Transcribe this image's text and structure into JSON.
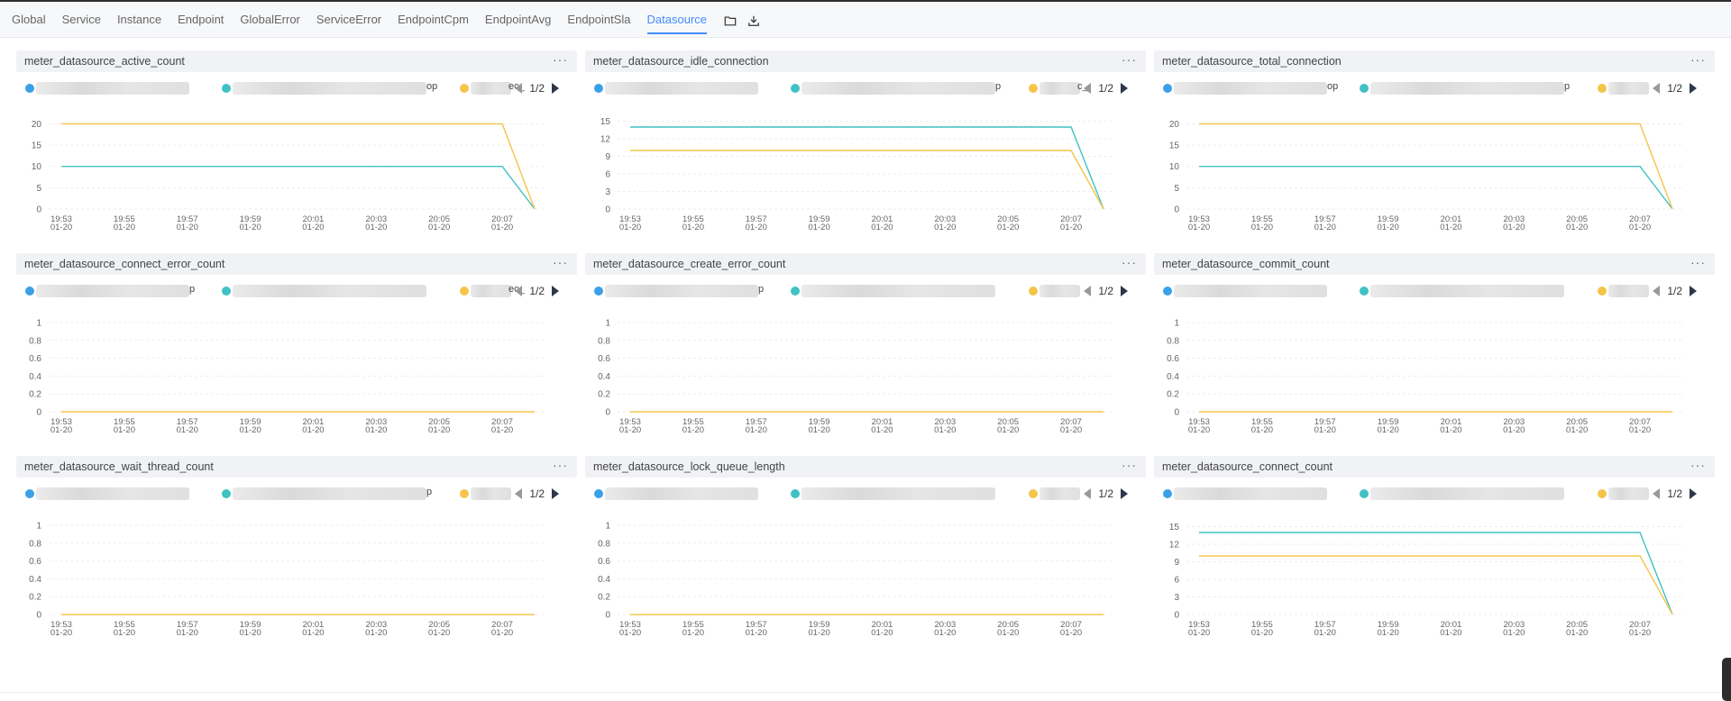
{
  "tabs": [
    {
      "label": "Global",
      "active": false
    },
    {
      "label": "Service",
      "active": false
    },
    {
      "label": "Instance",
      "active": false
    },
    {
      "label": "Endpoint",
      "active": false
    },
    {
      "label": "GlobalError",
      "active": false
    },
    {
      "label": "ServiceError",
      "active": false
    },
    {
      "label": "EndpointCpm",
      "active": false
    },
    {
      "label": "EndpointAvg",
      "active": false
    },
    {
      "label": "EndpointSla",
      "active": false
    },
    {
      "label": "Datasource",
      "active": true
    }
  ],
  "toolbar_icons": [
    "folder-icon",
    "download-icon"
  ],
  "colors": {
    "blue": "#3aa1e8",
    "teal": "#40c1c4",
    "yellow": "#f5c54b",
    "accent": "#448dfe"
  },
  "x_ticks": [
    {
      "time": "19:53",
      "date": "01-20"
    },
    {
      "time": "19:55",
      "date": "01-20"
    },
    {
      "time": "19:57",
      "date": "01-20"
    },
    {
      "time": "19:59",
      "date": "01-20"
    },
    {
      "time": "20:01",
      "date": "01-20"
    },
    {
      "time": "20:03",
      "date": "01-20"
    },
    {
      "time": "20:05",
      "date": "01-20"
    },
    {
      "time": "20:07",
      "date": "01-20"
    }
  ],
  "panels": [
    {
      "title": "meter_datasource_active_count",
      "menu": "···",
      "legend": {
        "tails": [
          "",
          "op",
          "ec_"
        ],
        "page": "1/2"
      },
      "chart_data": {
        "type": "line",
        "x": [
          "19:53",
          "19:54",
          "19:55",
          "19:56",
          "19:57",
          "19:58",
          "19:59",
          "20:00",
          "20:01",
          "20:02",
          "20:03",
          "20:04",
          "20:05",
          "20:06",
          "20:07",
          "20:08"
        ],
        "yticks": [
          "0",
          "5",
          "10",
          "15",
          "20"
        ],
        "ylim": [
          0,
          22
        ],
        "series": [
          {
            "color": "#40c1c4",
            "values": [
              10,
              10,
              10,
              10,
              10,
              10,
              10,
              10,
              10,
              10,
              10,
              10,
              10,
              10,
              10,
              0
            ]
          },
          {
            "color": "#f5c54b",
            "values": [
              20,
              20,
              20,
              20,
              20,
              20,
              20,
              20,
              20,
              20,
              20,
              20,
              20,
              20,
              20,
              0
            ]
          }
        ]
      }
    },
    {
      "title": "meter_datasource_idle_connection",
      "menu": "···",
      "legend": {
        "tails": [
          "",
          "p",
          "c_"
        ],
        "page": "1/2"
      },
      "chart_data": {
        "type": "line",
        "x": [
          "19:53",
          "19:54",
          "19:55",
          "19:56",
          "19:57",
          "19:58",
          "19:59",
          "20:00",
          "20:01",
          "20:02",
          "20:03",
          "20:04",
          "20:05",
          "20:06",
          "20:07",
          "20:08"
        ],
        "yticks": [
          "0",
          "3",
          "6",
          "9",
          "12",
          "15"
        ],
        "ylim": [
          0,
          16
        ],
        "series": [
          {
            "color": "#40c1c4",
            "values": [
              14,
              14,
              14,
              14,
              14,
              14,
              14,
              14,
              14,
              14,
              14,
              14,
              14,
              14,
              14,
              0
            ]
          },
          {
            "color": "#f5c54b",
            "values": [
              10,
              10,
              10,
              10,
              10,
              10,
              10,
              10,
              10,
              10,
              10,
              10,
              10,
              10,
              10,
              0
            ]
          }
        ]
      }
    },
    {
      "title": "meter_datasource_total_connection",
      "menu": "···",
      "legend": {
        "tails": [
          "op",
          "p",
          ""
        ],
        "page": "1/2"
      },
      "chart_data": {
        "type": "line",
        "x": [
          "19:53",
          "19:54",
          "19:55",
          "19:56",
          "19:57",
          "19:58",
          "19:59",
          "20:00",
          "20:01",
          "20:02",
          "20:03",
          "20:04",
          "20:05",
          "20:06",
          "20:07",
          "20:08"
        ],
        "yticks": [
          "0",
          "5",
          "10",
          "15",
          "20"
        ],
        "ylim": [
          0,
          22
        ],
        "series": [
          {
            "color": "#40c1c4",
            "values": [
              10,
              10,
              10,
              10,
              10,
              10,
              10,
              10,
              10,
              10,
              10,
              10,
              10,
              10,
              10,
              0
            ]
          },
          {
            "color": "#f5c54b",
            "values": [
              20,
              20,
              20,
              20,
              20,
              20,
              20,
              20,
              20,
              20,
              20,
              20,
              20,
              20,
              20,
              0
            ]
          }
        ]
      }
    },
    {
      "title": "meter_datasource_connect_error_count",
      "menu": "···",
      "legend": {
        "tails": [
          "p",
          "",
          "ec_"
        ],
        "page": "1/2"
      },
      "chart_data": {
        "type": "line",
        "x": [
          "19:53",
          "19:54",
          "19:55",
          "19:56",
          "19:57",
          "19:58",
          "19:59",
          "20:00",
          "20:01",
          "20:02",
          "20:03",
          "20:04",
          "20:05",
          "20:06",
          "20:07",
          "20:08"
        ],
        "yticks": [
          "0",
          "0.2",
          "0.4",
          "0.6",
          "0.8",
          "1"
        ],
        "ylim": [
          0,
          1.05
        ],
        "series": [
          {
            "color": "#f5c54b",
            "values": [
              0,
              0,
              0,
              0,
              0,
              0,
              0,
              0,
              0,
              0,
              0,
              0,
              0,
              0,
              0,
              0
            ]
          }
        ]
      }
    },
    {
      "title": "meter_datasource_create_error_count",
      "menu": "···",
      "legend": {
        "tails": [
          "p",
          "",
          ""
        ],
        "page": "1/2"
      },
      "chart_data": {
        "type": "line",
        "x": [
          "19:53",
          "19:54",
          "19:55",
          "19:56",
          "19:57",
          "19:58",
          "19:59",
          "20:00",
          "20:01",
          "20:02",
          "20:03",
          "20:04",
          "20:05",
          "20:06",
          "20:07",
          "20:08"
        ],
        "yticks": [
          "0",
          "0.2",
          "0.4",
          "0.6",
          "0.8",
          "1"
        ],
        "ylim": [
          0,
          1.05
        ],
        "series": [
          {
            "color": "#f5c54b",
            "values": [
              0,
              0,
              0,
              0,
              0,
              0,
              0,
              0,
              0,
              0,
              0,
              0,
              0,
              0,
              0,
              0
            ]
          }
        ]
      }
    },
    {
      "title": "meter_datasource_commit_count",
      "menu": "···",
      "legend": {
        "tails": [
          "",
          "",
          ""
        ],
        "page": "1/2"
      },
      "chart_data": {
        "type": "line",
        "x": [
          "19:53",
          "19:54",
          "19:55",
          "19:56",
          "19:57",
          "19:58",
          "19:59",
          "20:00",
          "20:01",
          "20:02",
          "20:03",
          "20:04",
          "20:05",
          "20:06",
          "20:07",
          "20:08"
        ],
        "yticks": [
          "0",
          "0.2",
          "0.4",
          "0.6",
          "0.8",
          "1"
        ],
        "ylim": [
          0,
          1.05
        ],
        "series": [
          {
            "color": "#f5c54b",
            "values": [
              0,
              0,
              0,
              0,
              0,
              0,
              0,
              0,
              0,
              0,
              0,
              0,
              0,
              0,
              0,
              0
            ]
          }
        ]
      }
    },
    {
      "title": "meter_datasource_wait_thread_count",
      "menu": "···",
      "legend": {
        "tails": [
          "",
          "p",
          ""
        ],
        "page": "1/2"
      },
      "chart_data": {
        "type": "line",
        "x": [
          "19:53",
          "19:54",
          "19:55",
          "19:56",
          "19:57",
          "19:58",
          "19:59",
          "20:00",
          "20:01",
          "20:02",
          "20:03",
          "20:04",
          "20:05",
          "20:06",
          "20:07",
          "20:08"
        ],
        "yticks": [
          "0",
          "0.2",
          "0.4",
          "0.6",
          "0.8",
          "1"
        ],
        "ylim": [
          0,
          1.05
        ],
        "series": [
          {
            "color": "#f5c54b",
            "values": [
              0,
              0,
              0,
              0,
              0,
              0,
              0,
              0,
              0,
              0,
              0,
              0,
              0,
              0,
              0,
              0
            ]
          }
        ]
      }
    },
    {
      "title": "meter_datasource_lock_queue_length",
      "menu": "···",
      "legend": {
        "tails": [
          "",
          "",
          ""
        ],
        "page": "1/2"
      },
      "chart_data": {
        "type": "line",
        "x": [
          "19:53",
          "19:54",
          "19:55",
          "19:56",
          "19:57",
          "19:58",
          "19:59",
          "20:00",
          "20:01",
          "20:02",
          "20:03",
          "20:04",
          "20:05",
          "20:06",
          "20:07",
          "20:08"
        ],
        "yticks": [
          "0",
          "0.2",
          "0.4",
          "0.6",
          "0.8",
          "1"
        ],
        "ylim": [
          0,
          1.05
        ],
        "series": [
          {
            "color": "#f5c54b",
            "values": [
              0,
              0,
              0,
              0,
              0,
              0,
              0,
              0,
              0,
              0,
              0,
              0,
              0,
              0,
              0,
              0
            ]
          }
        ]
      }
    },
    {
      "title": "meter_datasource_connect_count",
      "menu": "···",
      "legend": {
        "tails": [
          "",
          "",
          ""
        ],
        "page": "1/2"
      },
      "chart_data": {
        "type": "line",
        "x": [
          "19:53",
          "19:54",
          "19:55",
          "19:56",
          "19:57",
          "19:58",
          "19:59",
          "20:00",
          "20:01",
          "20:02",
          "20:03",
          "20:04",
          "20:05",
          "20:06",
          "20:07",
          "20:08"
        ],
        "yticks": [
          "0",
          "3",
          "6",
          "9",
          "12",
          "15"
        ],
        "ylim": [
          0,
          16
        ],
        "series": [
          {
            "color": "#40c1c4",
            "values": [
              14,
              14,
              14,
              14,
              14,
              14,
              14,
              14,
              14,
              14,
              14,
              14,
              14,
              14,
              14,
              0
            ]
          },
          {
            "color": "#f5c54b",
            "values": [
              10,
              10,
              10,
              10,
              10,
              10,
              10,
              10,
              10,
              10,
              10,
              10,
              10,
              10,
              10,
              0
            ]
          }
        ]
      }
    }
  ]
}
